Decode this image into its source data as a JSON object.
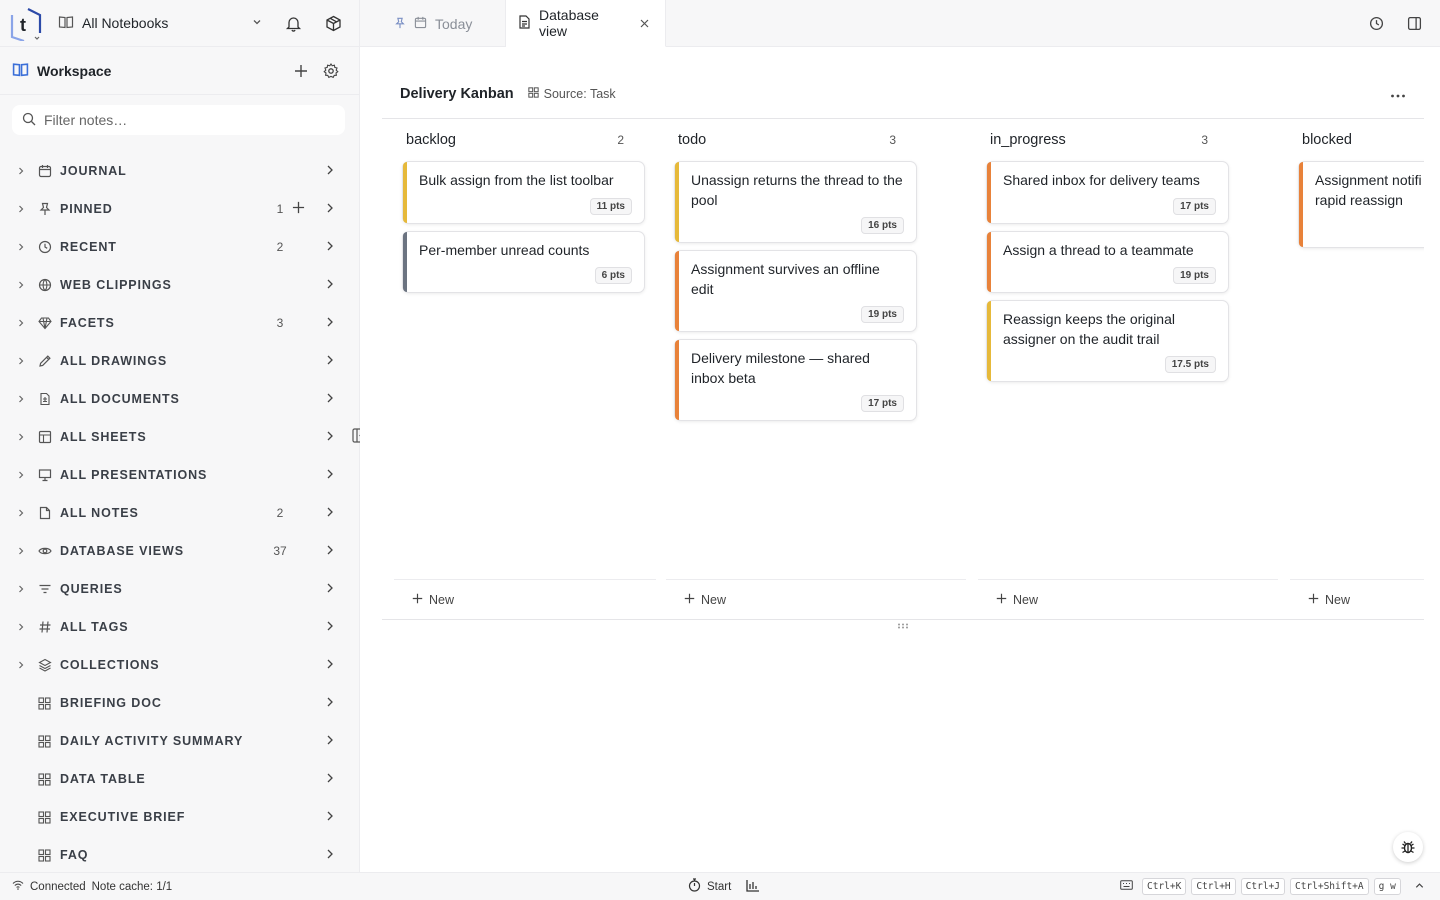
{
  "sidebar": {
    "notebook_selector": "All Notebooks",
    "workspace_title": "Workspace",
    "filter_placeholder": "Filter notes…",
    "items": [
      {
        "label": "JOURNAL",
        "icon": "calendar-icon",
        "count": ""
      },
      {
        "label": "PINNED",
        "icon": "pin-icon",
        "count": "1"
      },
      {
        "label": "RECENT",
        "icon": "clock-icon",
        "count": "2"
      },
      {
        "label": "WEB CLIPPINGS",
        "icon": "globe-icon",
        "count": ""
      },
      {
        "label": "FACETS",
        "icon": "gem-icon",
        "count": "3"
      },
      {
        "label": "ALL DRAWINGS",
        "icon": "pencil-icon",
        "count": ""
      },
      {
        "label": "ALL DOCUMENTS",
        "icon": "document-icon",
        "count": ""
      },
      {
        "label": "ALL SHEETS",
        "icon": "sheet-icon",
        "count": ""
      },
      {
        "label": "ALL PRESENTATIONS",
        "icon": "presentation-icon",
        "count": ""
      },
      {
        "label": "ALL NOTES",
        "icon": "note-icon",
        "count": "2"
      },
      {
        "label": "DATABASE VIEWS",
        "icon": "eye-icon",
        "count": "37"
      },
      {
        "label": "QUERIES",
        "icon": "filter-icon",
        "count": ""
      },
      {
        "label": "ALL TAGS",
        "icon": "hash-icon",
        "count": ""
      },
      {
        "label": "COLLECTIONS",
        "icon": "layers-icon",
        "count": ""
      },
      {
        "label": "BRIEFING DOC",
        "icon": "grid-icon",
        "count": ""
      },
      {
        "label": "DAILY ACTIVITY SUMMARY",
        "icon": "grid-icon",
        "count": ""
      },
      {
        "label": "DATA TABLE",
        "icon": "grid-icon",
        "count": ""
      },
      {
        "label": "EXECUTIVE BRIEF",
        "icon": "grid-icon",
        "count": ""
      },
      {
        "label": "FAQ",
        "icon": "grid-icon",
        "count": ""
      }
    ]
  },
  "tabs": [
    {
      "label": "Today",
      "active": false
    },
    {
      "label": "Database view",
      "active": true
    }
  ],
  "view": {
    "title": "Delivery Kanban",
    "source": "Source: Task",
    "new_label": "New",
    "columns": [
      {
        "name": "backlog",
        "count": "2",
        "cards": [
          {
            "title": "Bulk assign from the list toolbar",
            "pts": "11 pts",
            "color": "#e6b93a"
          },
          {
            "title": "Per-member unread counts",
            "pts": "6 pts",
            "color": "#6b7380"
          }
        ]
      },
      {
        "name": "todo",
        "count": "3",
        "cards": [
          {
            "title": "Unassign returns the thread to the pool",
            "pts": "16 pts",
            "color": "#e6b93a"
          },
          {
            "title": "Assignment survives an offline edit",
            "pts": "19 pts",
            "color": "#e8823a"
          },
          {
            "title": "Delivery milestone — shared inbox beta",
            "pts": "17 pts",
            "color": "#e8823a"
          }
        ]
      },
      {
        "name": "in_progress",
        "count": "3",
        "cards": [
          {
            "title": "Shared inbox for delivery teams",
            "pts": "17 pts",
            "color": "#e8823a"
          },
          {
            "title": "Assign a thread to a teammate",
            "pts": "19 pts",
            "color": "#e8823a"
          },
          {
            "title": "Reassign keeps the original assigner on the audit trail",
            "pts": "17.5 pts",
            "color": "#e6b93a"
          }
        ]
      },
      {
        "name": "blocked",
        "count": "",
        "cards": [
          {
            "title": "Assignment notifi rapid reassign",
            "pts": "",
            "color": "#e8823a"
          }
        ]
      }
    ]
  },
  "statusbar": {
    "connection": "Connected",
    "cache": "Note cache: 1/1",
    "start": "Start",
    "shortcuts": [
      "Ctrl+K",
      "Ctrl+H",
      "Ctrl+J",
      "Ctrl+Shift+A",
      "g w"
    ]
  },
  "colors": {
    "accent": "#3b6fd8",
    "bar_yellow": "#e6b93a",
    "bar_orange": "#e8823a",
    "bar_gray": "#6b7380"
  }
}
